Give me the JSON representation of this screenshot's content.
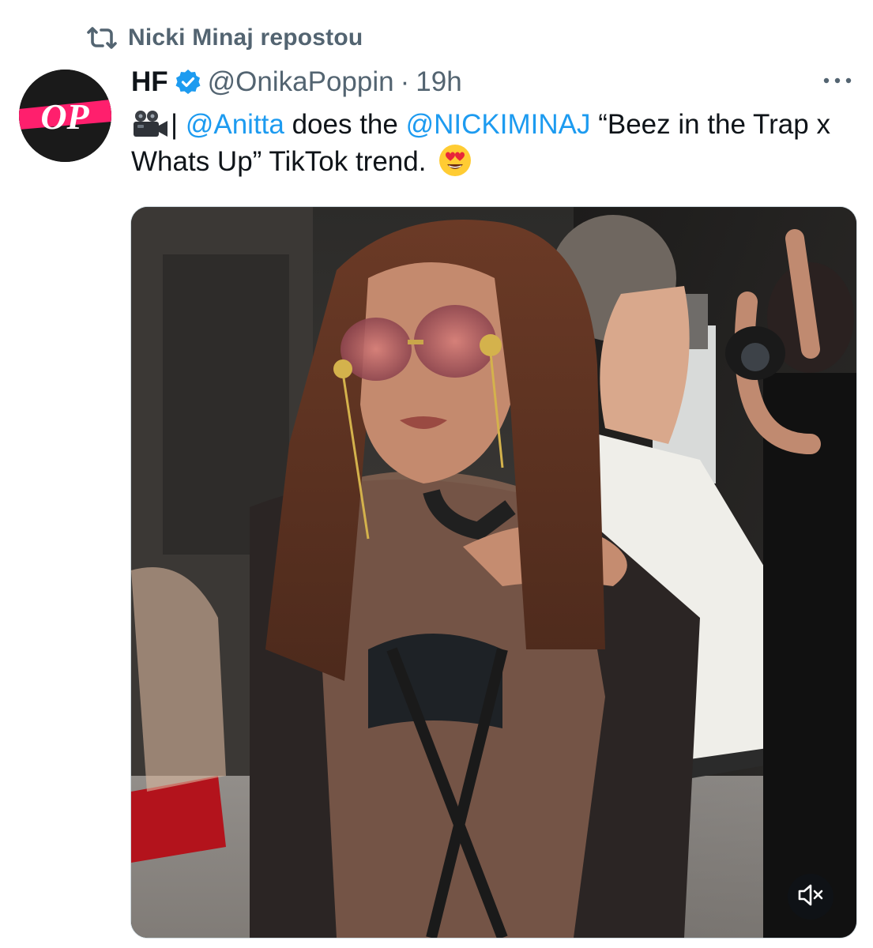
{
  "repost": {
    "icon": "repost-icon",
    "text": "Nicki Minaj repostou"
  },
  "tweet": {
    "avatar": {
      "text": "OP",
      "background_color": "#1a1a1a",
      "band_color": "#ff1f6d"
    },
    "author_name": "HF",
    "verified_icon": "verified-badge-icon",
    "verified_color": "#1d9bf0",
    "handle": "@OnikaPoppin",
    "separator": "·",
    "time": "19h",
    "more_icon": "more-horizontal-icon",
    "text": {
      "emoji_prefix_icon": "movie-camera-emoji",
      "divider": "|",
      "mention_1": "@Anitta",
      "middle_1": " does the ",
      "mention_2": "@NICKIMINAJ",
      "rest": " “Beez in the Trap x Whats Up” TikTok trend.",
      "emoji_suffix_icon": "heart-eyes-emoji"
    },
    "media": {
      "type": "video",
      "mute_icon": "volume-muted-icon"
    }
  },
  "colors": {
    "text_primary": "#0f1419",
    "text_secondary": "#536471",
    "link": "#1d9bf0"
  }
}
